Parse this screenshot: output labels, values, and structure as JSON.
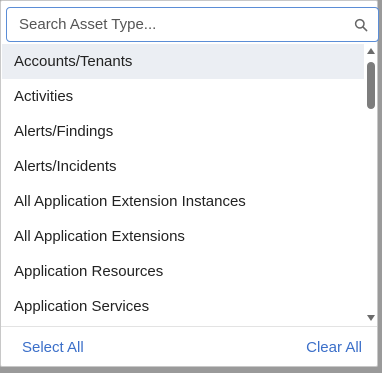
{
  "search": {
    "placeholder": "Search Asset Type...",
    "value": ""
  },
  "list": {
    "items": [
      {
        "label": "Accounts/Tenants",
        "highlighted": true
      },
      {
        "label": "Activities",
        "highlighted": false
      },
      {
        "label": "Alerts/Findings",
        "highlighted": false
      },
      {
        "label": "Alerts/Incidents",
        "highlighted": false
      },
      {
        "label": "All Application Extension Instances",
        "highlighted": false
      },
      {
        "label": "All Application Extensions",
        "highlighted": false
      },
      {
        "label": "Application Resources",
        "highlighted": false
      },
      {
        "label": "Application Services",
        "highlighted": false
      }
    ]
  },
  "footer": {
    "select_all_label": "Select All",
    "clear_all_label": "Clear All"
  },
  "colors": {
    "accent": "#3b6fc9",
    "focus_border": "#5b8dd6",
    "highlight_row": "#ebeef3"
  },
  "icons": {
    "search": "search-icon"
  }
}
